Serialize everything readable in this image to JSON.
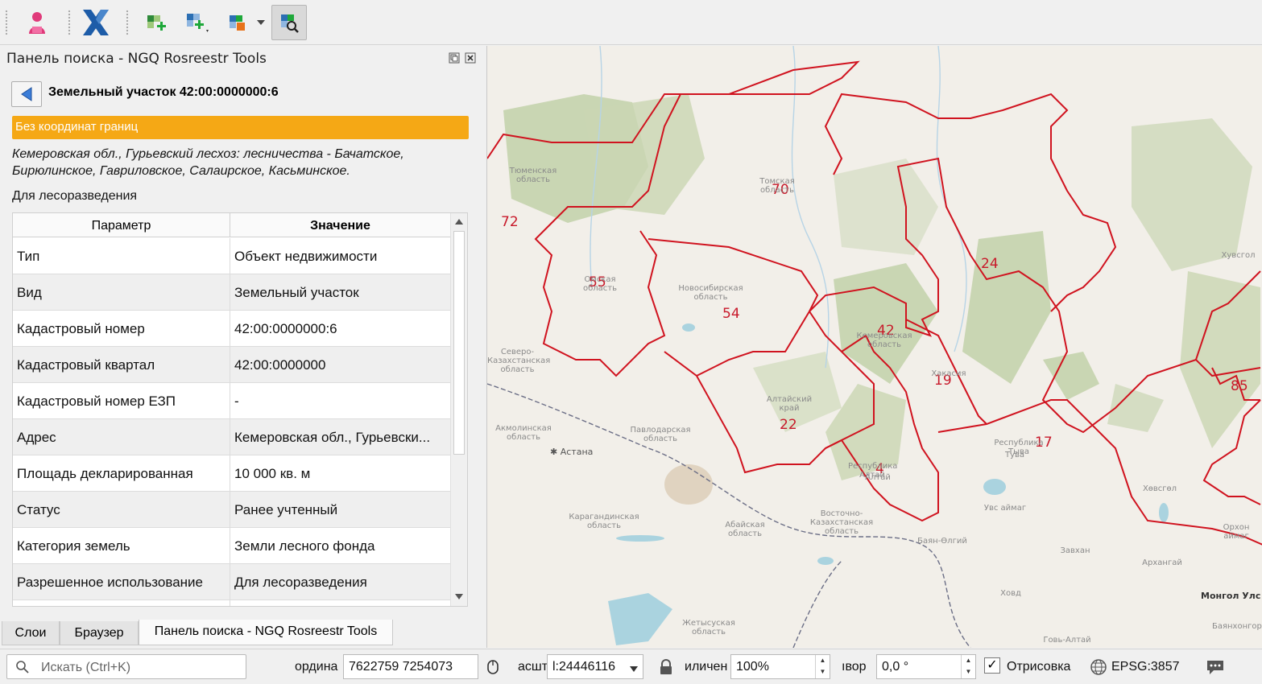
{
  "toolbar": {
    "buttons": [
      "user-icon",
      "x-icon",
      "add-layer-icon",
      "add-layer-dropdown-icon",
      "layer-export-icon",
      "search-panel-icon"
    ]
  },
  "panel": {
    "title": "Панель поиска - NGQ Rosreestr Tools",
    "object_title": "Земельный участок 42:00:0000000:6",
    "status_banner": "Без координат границ",
    "address": "Кемеровская обл., Гурьевский лесхоз: лесничества - Бачатское, Бирюлинское, Гавриловское, Салаирское, Касьминское.",
    "usage": "Для лесоразведения",
    "banner_color": "#f5a815",
    "table": {
      "header_param": "Параметр",
      "header_value": "Значение",
      "rows": [
        {
          "param": "Тип",
          "value": "Объект недвижимости"
        },
        {
          "param": "Вид",
          "value": "Земельный участок"
        },
        {
          "param": "Кадастровый номер",
          "value": "42:00:0000000:6"
        },
        {
          "param": "Кадастровый квартал",
          "value": "42:00:0000000"
        },
        {
          "param": "Кадастровый номер ЕЗП",
          "value": "-"
        },
        {
          "param": "Адрес",
          "value": "Кемеровская обл.,  Гурьевски..."
        },
        {
          "param": "Площадь декларированная",
          "value": "10 000 кв. м"
        },
        {
          "param": "Статус",
          "value": "Ранее учтенный"
        },
        {
          "param": "Категория земель",
          "value": "Земли лесного фонда"
        },
        {
          "param": "Разрешенное использование",
          "value": "Для лесоразведения"
        }
      ]
    }
  },
  "dock_tabs": [
    "Слои",
    "Браузер",
    "Панель поиска - NGQ Rosreestr Tools"
  ],
  "map": {
    "region_numbers": [
      "72",
      "70",
      "55",
      "54",
      "24",
      "42",
      "19",
      "85",
      "22",
      "17",
      "4"
    ],
    "labels": [
      "Тюменская область",
      "Томская область",
      "Омская область",
      "Новосибирская область",
      "Кемеровская область",
      "Хакасия",
      "Алтайский край",
      "Павлодарская область",
      "Северо-Казахстанская область",
      "Акмолинская область",
      "Карагандинская область",
      "Абайская область",
      "Восточно-Казахстанская область",
      "Республика Алтай",
      "Республика Тыва",
      "Жетысуская область",
      "Увс аймаг",
      "Завхан",
      "Архангай",
      "Ховд",
      "Баян-Өлгий",
      "Говь-Алтай",
      "Хөвсгөл",
      "Орхон аймаг",
      "Баянхонгор",
      "Хувсгол",
      "Тува",
      "Алтай"
    ],
    "city": "Астана",
    "country": "Монгол Улс",
    "border_color": "#d0131f"
  },
  "statusbar": {
    "search_placeholder": "Искать (Ctrl+K)",
    "coord_label": "ордина",
    "coord_value": "7622759  7254073",
    "scale_label": "асшт",
    "scale_value": "l:24446116",
    "magnifier_label": "иличен",
    "magnifier_value": "100%",
    "rotation_label": "ıвор",
    "rotation_value": "0,0 °",
    "render_label": "Отрисовка",
    "render_checked": true,
    "crs": "EPSG:3857"
  }
}
